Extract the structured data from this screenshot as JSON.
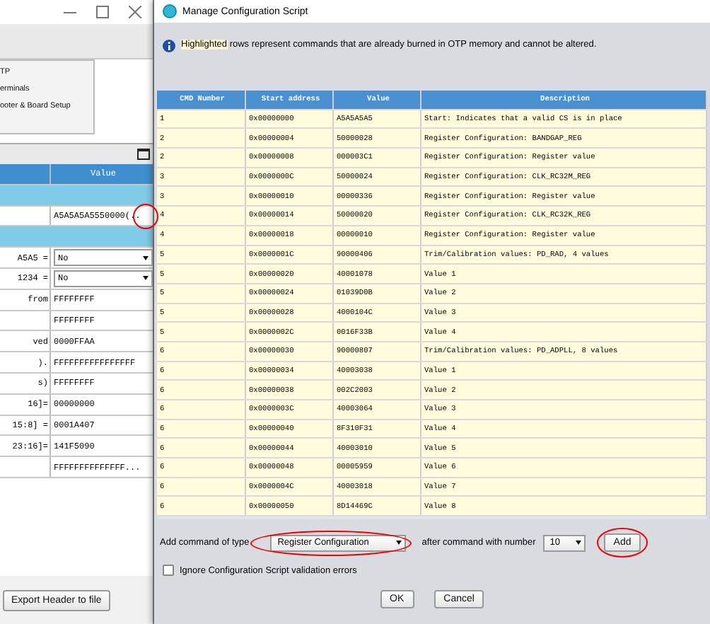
{
  "background_window": {
    "menu_items": [
      "TP",
      "erminals",
      "ooter & Board Setup"
    ],
    "table": {
      "columns": [
        "Value"
      ],
      "rows": [
        {
          "kind": "group"
        },
        {
          "kind": "text",
          "value": "A5A5A5A5550000(..",
          "annotated": true
        },
        {
          "kind": "group"
        },
        {
          "kind": "select",
          "label": "A5A5 =",
          "value": "No"
        },
        {
          "kind": "select",
          "label": "1234 =",
          "value": "No"
        },
        {
          "kind": "text",
          "label": "from",
          "value": "FFFFFFFF"
        },
        {
          "kind": "text",
          "value": "FFFFFFFF"
        },
        {
          "kind": "text",
          "label": "ved",
          "value": "0000FFAA"
        },
        {
          "kind": "text",
          "label": ").",
          "value": "FFFFFFFFFFFFFFFF"
        },
        {
          "kind": "text",
          "label": "s)",
          "value": "FFFFFFFF"
        },
        {
          "kind": "text",
          "label": "16]=",
          "value": "00000000"
        },
        {
          "kind": "text",
          "label": "15:8] =",
          "value": "0001A407"
        },
        {
          "kind": "text",
          "label": "23:16]=",
          "value": "141F5090"
        },
        {
          "kind": "text",
          "value": "FFFFFFFFFFFFFF..."
        }
      ]
    },
    "export_button": "Export Header to file"
  },
  "dialog": {
    "title": "Manage Configuration Script",
    "info": {
      "highlight": "Highlighted",
      "text": " rows represent commands that are already burned in OTP memory and cannot be altered."
    },
    "table": {
      "columns": [
        "CMD Number",
        "Start address",
        "Value",
        "Description"
      ],
      "rows": [
        {
          "cells": [
            "1",
            "0x00000000",
            "A5A5A5A5",
            "Start: Indicates that a valid CS is in place"
          ],
          "highlighted": true
        },
        {
          "cells": [
            "2",
            "0x00000004",
            "50000028",
            "Register Configuration: BANDGAP_REG"
          ],
          "highlighted": true
        },
        {
          "cells": [
            "2",
            "0x00000008",
            "000003C1",
            "Register Configuration: Register value"
          ],
          "highlighted": true
        },
        {
          "cells": [
            "3",
            "0x0000000C",
            "50000024",
            "Register Configuration: CLK_RC32M_REG"
          ],
          "highlighted": true
        },
        {
          "cells": [
            "3",
            "0x00000010",
            "00000336",
            "Register Configuration: Register value"
          ],
          "highlighted": true
        },
        {
          "cells": [
            "4",
            "0x00000014",
            "50000020",
            "Register Configuration: CLK_RC32K_REG"
          ],
          "highlighted": true
        },
        {
          "cells": [
            "4",
            "0x00000018",
            "00000010",
            "Register Configuration: Register value"
          ],
          "highlighted": true
        },
        {
          "cells": [
            "5",
            "0x0000001C",
            "90000406",
            "Trim/Calibration values: PD_RAD, 4 values"
          ],
          "highlighted": true
        },
        {
          "cells": [
            "5",
            "0x00000020",
            "40001078",
            "Value 1"
          ],
          "highlighted": true
        },
        {
          "cells": [
            "5",
            "0x00000024",
            "01039D0B",
            "Value 2"
          ],
          "highlighted": true
        },
        {
          "cells": [
            "5",
            "0x00000028",
            "4000104C",
            "Value 3"
          ],
          "highlighted": true
        },
        {
          "cells": [
            "5",
            "0x0000002C",
            "0016F33B",
            "Value 4"
          ],
          "highlighted": true
        },
        {
          "cells": [
            "6",
            "0x00000030",
            "90000807",
            "Trim/Calibration values: PD_ADPLL, 8 values"
          ],
          "highlighted": true
        },
        {
          "cells": [
            "6",
            "0x00000034",
            "40003038",
            "Value 1"
          ],
          "highlighted": true
        },
        {
          "cells": [
            "6",
            "0x00000038",
            "002C2003",
            "Value 2"
          ],
          "highlighted": true
        },
        {
          "cells": [
            "6",
            "0x0000003C",
            "40003064",
            "Value 3"
          ],
          "highlighted": true
        },
        {
          "cells": [
            "6",
            "0x00000040",
            "8F310F31",
            "Value 4"
          ],
          "highlighted": true
        },
        {
          "cells": [
            "6",
            "0x00000044",
            "40003010",
            "Value 5"
          ],
          "highlighted": true
        },
        {
          "cells": [
            "6",
            "0x00000048",
            "00005959",
            "Value 6"
          ],
          "highlighted": true
        },
        {
          "cells": [
            "6",
            "0x0000004C",
            "40003018",
            "Value 7"
          ],
          "highlighted": true
        },
        {
          "cells": [
            "6",
            "0x00000050",
            "8D14469C",
            "Value 8"
          ],
          "highlighted": true
        }
      ]
    },
    "add_label": "Add command of type",
    "command_type": "Register Configuration",
    "after_label": "after command with number",
    "command_number": "10",
    "add_button": "Add",
    "ignore_errors": {
      "label": "Ignore Configuration Script validation errors",
      "checked": false
    },
    "buttons": [
      "OK",
      "Cancel"
    ]
  }
}
